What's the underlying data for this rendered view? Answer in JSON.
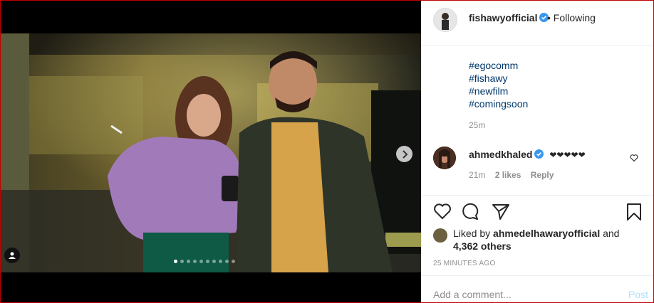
{
  "post": {
    "username": "fishawyofficial",
    "follow_status": "Following",
    "separator": "•",
    "hashtags": [
      "#egocomm",
      "#fishawy",
      "#newfilm",
      "#comingsoon"
    ],
    "caption_time": "25m"
  },
  "comment": {
    "username": "ahmedkhaled",
    "text": "❤❤❤❤❤",
    "time": "21m",
    "likes": "2 likes",
    "reply_label": "Reply"
  },
  "likes": {
    "prefix": "Liked by",
    "user": "ahmedelhawaryofficial",
    "and": "and",
    "others": "4,362 others"
  },
  "timestamp": "25 MINUTES AGO",
  "add_comment": {
    "placeholder": "Add a comment...",
    "post_label": "Post"
  },
  "carousel": {
    "total": 10,
    "current": 1
  },
  "colors": {
    "verified": "#3897f0",
    "link": "#00376b",
    "post_disabled": "#b2dffc"
  },
  "icons": [
    "heart-icon",
    "comment-icon",
    "share-icon",
    "bookmark-icon",
    "chevron-right-icon",
    "tag-person-icon",
    "verified-icon"
  ]
}
